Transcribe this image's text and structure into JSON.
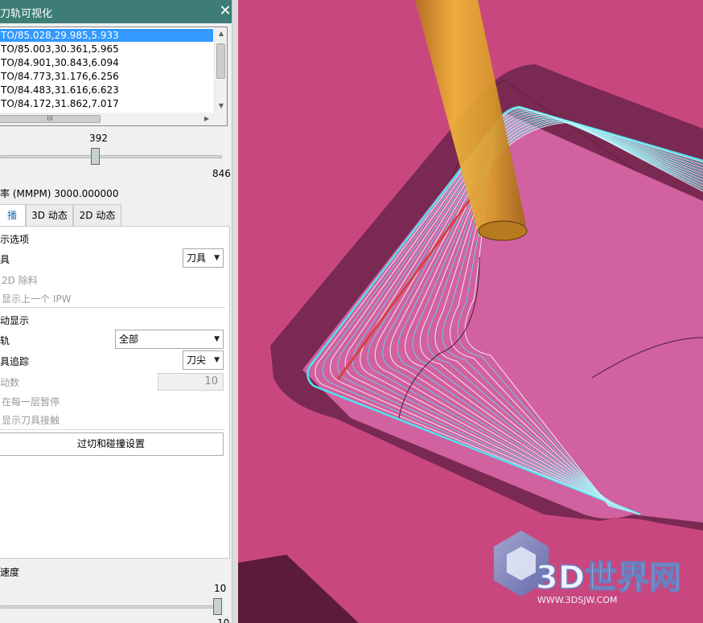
{
  "dialog": {
    "title": "刀轨可视化",
    "close_icon": "close-icon",
    "toolpath_list": [
      "TO/85.028,29.985,5.933",
      "TO/85.003,30.361,5.965",
      "TO/84.901,30.843,6.094",
      "TO/84.773,31.176,6.256",
      "TO/84.483,31.616,6.623",
      "TO/84.172,31.862,7.017"
    ],
    "selected_row_index": 0,
    "hscroll_grip": "III",
    "position_slider": {
      "value": "392",
      "max": "846",
      "value_num": 392,
      "max_num": 846
    },
    "feed_rate_label": "率 (MMPM) 3000.000000",
    "tabs": [
      "播",
      "3D 动态",
      "2D 动态"
    ],
    "active_tab_index": 0,
    "display_options_header": "示选项",
    "tool_label": "具",
    "tool_dropdown_value": "刀具",
    "remove_2d_label": "2D 除料",
    "show_prev_ipw_label": "显示上一个 IPW",
    "motion_display_header": "动显示",
    "toolpath_label": "轨",
    "toolpath_dropdown_value": "全部",
    "tool_trace_label": "具追踪",
    "tool_trace_dropdown_value": "刀尖",
    "motion_count_label": "动数",
    "motion_count_value": "10",
    "pause_each_layer_label": "在每一层暂停",
    "show_tool_contact_label": "显示刀具接触",
    "gouge_button_label": "过切和碰撞设置",
    "speed_label": "速度",
    "speed_slider": {
      "value_top": "10",
      "value_bottom": "10",
      "value_num": 10,
      "max_num": 10
    }
  },
  "viewport": {
    "colors": {
      "background": "#c9477f",
      "pocket_wall": "#7a2a52",
      "toolpath": "#4fe3ee",
      "tool": "#d99a2a",
      "cut_line": "#d94040"
    },
    "watermark": {
      "brand": "3D世界网",
      "url": "WWW.3DSJW.COM",
      "logo_icon": "cube-logo-icon"
    }
  }
}
